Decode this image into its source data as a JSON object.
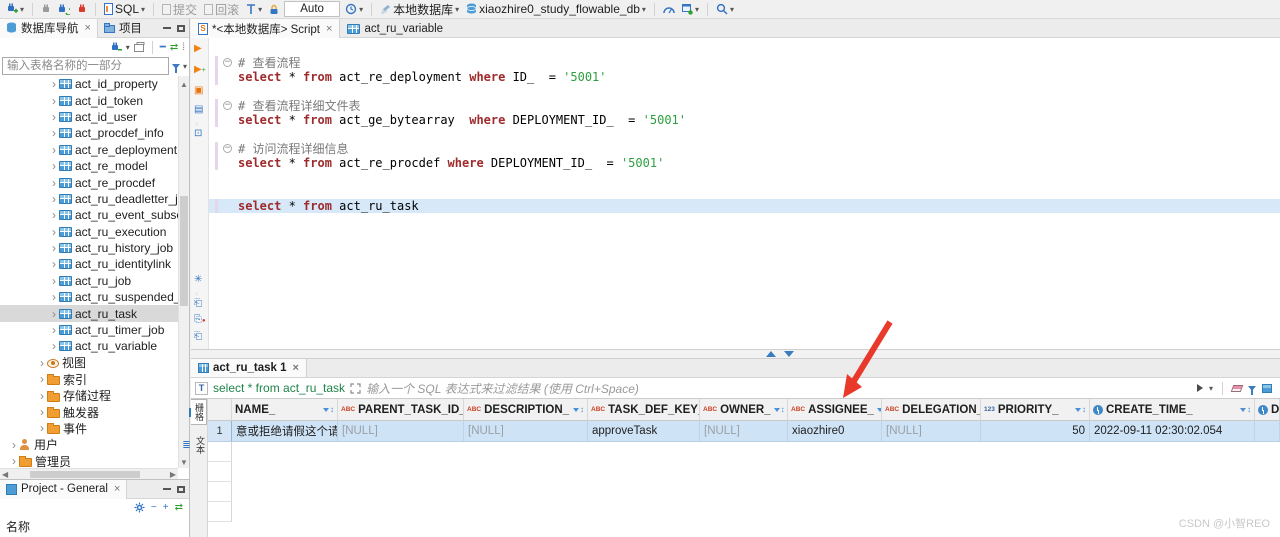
{
  "colors": {
    "keyword": "#9e2a2b",
    "string": "#2e9e3e",
    "comment": "#7a7a7a",
    "selected_row": "#cfe3f6",
    "filter_query": "#1e8449",
    "arrow": "#e8392b"
  },
  "topbar": {
    "sql_label": "SQL",
    "commit_label": "提交",
    "rollback_label": "回滚",
    "auto_label": "Auto",
    "db_button_label": "本地数据库",
    "schema_button_label": "xiaozhire0_study_flowable_db"
  },
  "sidebar": {
    "tab_navigator": "数据库导航",
    "tab_project": "项目",
    "filter_placeholder": "输入表格名称的一部分",
    "tree": [
      {
        "label": "act_id_property",
        "icon": "table",
        "depth": 3
      },
      {
        "label": "act_id_token",
        "icon": "table",
        "depth": 3
      },
      {
        "label": "act_id_user",
        "icon": "table",
        "depth": 3
      },
      {
        "label": "act_procdef_info",
        "icon": "table",
        "depth": 3
      },
      {
        "label": "act_re_deployment",
        "icon": "table",
        "depth": 3
      },
      {
        "label": "act_re_model",
        "icon": "table",
        "depth": 3
      },
      {
        "label": "act_re_procdef",
        "icon": "table",
        "depth": 3
      },
      {
        "label": "act_ru_deadletter_job",
        "icon": "table",
        "depth": 3
      },
      {
        "label": "act_ru_event_subscr",
        "icon": "table",
        "depth": 3
      },
      {
        "label": "act_ru_execution",
        "icon": "table",
        "depth": 3
      },
      {
        "label": "act_ru_history_job",
        "icon": "table",
        "depth": 3
      },
      {
        "label": "act_ru_identitylink",
        "icon": "table",
        "depth": 3
      },
      {
        "label": "act_ru_job",
        "icon": "table",
        "depth": 3
      },
      {
        "label": "act_ru_suspended_job",
        "icon": "table",
        "depth": 3
      },
      {
        "label": "act_ru_task",
        "icon": "table",
        "depth": 3,
        "selected": true
      },
      {
        "label": "act_ru_timer_job",
        "icon": "table",
        "depth": 3
      },
      {
        "label": "act_ru_variable",
        "icon": "table",
        "depth": 3
      },
      {
        "label": "视图",
        "icon": "views",
        "depth": 2
      },
      {
        "label": "索引",
        "icon": "folder",
        "depth": 2
      },
      {
        "label": "存储过程",
        "icon": "folder",
        "depth": 2
      },
      {
        "label": "触发器",
        "icon": "folder",
        "depth": 2
      },
      {
        "label": "事件",
        "icon": "folder",
        "depth": 2
      },
      {
        "label": "用户",
        "icon": "user",
        "depth": 1
      },
      {
        "label": "管理员",
        "icon": "folder",
        "depth": 1
      }
    ]
  },
  "project_panel": {
    "tab_label": "Project - General",
    "name_label": "名称"
  },
  "editor": {
    "tabs": [
      {
        "label": "*<本地数据库> Script",
        "active": true
      },
      {
        "label": "act_ru_variable",
        "active": false
      }
    ],
    "sql_lines": [
      {
        "fold": true,
        "tokens": [
          {
            "c": "cm",
            "t": "# 查看流程"
          }
        ]
      },
      {
        "tokens": [
          {
            "c": "kw",
            "t": "select"
          },
          {
            "c": "pl",
            "t": " * "
          },
          {
            "c": "kw",
            "t": "from"
          },
          {
            "c": "pl",
            "t": " act_re_deployment "
          },
          {
            "c": "kw",
            "t": "where"
          },
          {
            "c": "pl",
            "t": " ID_  = "
          },
          {
            "c": "str",
            "t": "'5001'"
          }
        ]
      },
      {
        "tokens": []
      },
      {
        "fold": true,
        "tokens": [
          {
            "c": "cm",
            "t": "# 查看流程详细文件表"
          }
        ]
      },
      {
        "tokens": [
          {
            "c": "kw",
            "t": "select"
          },
          {
            "c": "pl",
            "t": " * "
          },
          {
            "c": "kw",
            "t": "from"
          },
          {
            "c": "pl",
            "t": " act_ge_bytearray  "
          },
          {
            "c": "kw",
            "t": "where"
          },
          {
            "c": "pl",
            "t": " DEPLOYMENT_ID_  = "
          },
          {
            "c": "str",
            "t": "'5001'"
          }
        ]
      },
      {
        "tokens": []
      },
      {
        "fold": true,
        "tokens": [
          {
            "c": "cm",
            "t": "# 访问流程详细信息"
          }
        ]
      },
      {
        "tokens": [
          {
            "c": "kw",
            "t": "select"
          },
          {
            "c": "pl",
            "t": " * "
          },
          {
            "c": "kw",
            "t": "from"
          },
          {
            "c": "pl",
            "t": " act_re_procdef "
          },
          {
            "c": "kw",
            "t": "where"
          },
          {
            "c": "pl",
            "t": " DEPLOYMENT_ID_  = "
          },
          {
            "c": "str",
            "t": "'5001'"
          }
        ]
      },
      {
        "tokens": []
      },
      {
        "tokens": []
      },
      {
        "highlight": true,
        "tokens": [
          {
            "c": "kw",
            "t": "select"
          },
          {
            "c": "pl",
            "t": " * "
          },
          {
            "c": "kw",
            "t": "from"
          },
          {
            "c": "pl",
            "t": " act_ru_task"
          }
        ]
      }
    ]
  },
  "results": {
    "tab_label": "act_ru_task 1",
    "filter_query": "select * from act_ru_task",
    "filter_placeholder": "输入一个 SQL 表达式来过滤结果 (使用 Ctrl+Space)",
    "side_tabs": [
      {
        "label": "栅格",
        "active": true
      },
      {
        "label": "文本",
        "active": false
      }
    ],
    "grid": {
      "columns": [
        {
          "label": "NAME_",
          "type": "",
          "width": 106
        },
        {
          "label": "PARENT_TASK_ID_",
          "type": "abc",
          "width": 126
        },
        {
          "label": "DESCRIPTION_",
          "type": "abc",
          "width": 124
        },
        {
          "label": "TASK_DEF_KEY_",
          "type": "abc",
          "width": 112
        },
        {
          "label": "OWNER_",
          "type": "abc",
          "width": 88
        },
        {
          "label": "ASSIGNEE_",
          "type": "abc",
          "width": 94
        },
        {
          "label": "DELEGATION_",
          "type": "abc",
          "width": 99
        },
        {
          "label": "PRIORITY_",
          "type": "123",
          "width": 109,
          "align": "right"
        },
        {
          "label": "CREATE_TIME_",
          "type": "clock",
          "width": 165
        },
        {
          "label": "DU",
          "type": "clock",
          "width": 40
        }
      ],
      "rows": [
        {
          "num": "1",
          "cells": [
            {
              "v": "意或拒绝请假这个请求"
            },
            {
              "v": "[NULL]",
              "null": true
            },
            {
              "v": "[NULL]",
              "null": true
            },
            {
              "v": "approveTask"
            },
            {
              "v": "[NULL]",
              "null": true
            },
            {
              "v": "xiaozhire0"
            },
            {
              "v": "[NULL]",
              "null": true
            },
            {
              "v": "50",
              "align": "right"
            },
            {
              "v": "2022-09-11 02:30:02.054"
            },
            {
              "v": ""
            }
          ]
        }
      ]
    }
  },
  "watermark": "CSDN @小智REO"
}
